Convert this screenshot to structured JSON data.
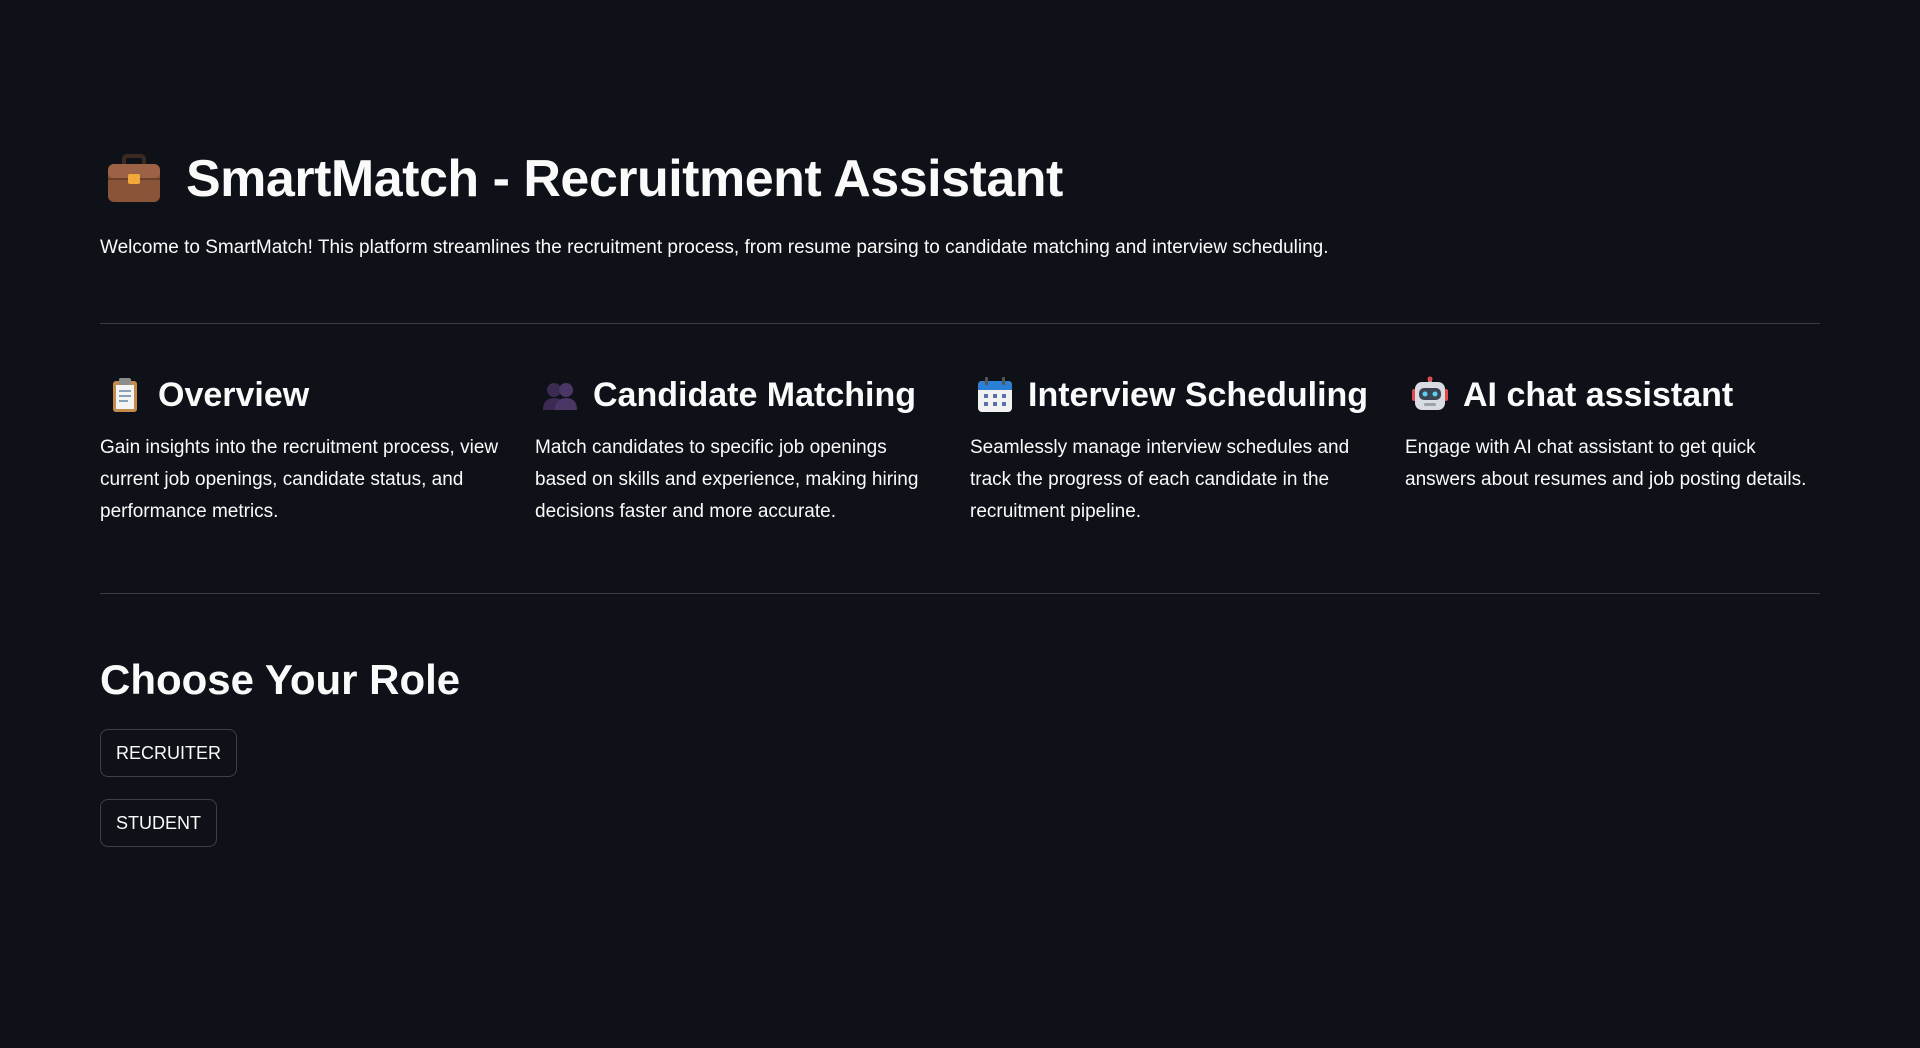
{
  "header": {
    "icon": "briefcase-icon",
    "title": "SmartMatch - Recruitment Assistant",
    "welcome": "Welcome to SmartMatch! This platform streamlines the recruitment process, from resume parsing to candidate matching and interview scheduling."
  },
  "features": [
    {
      "icon": "clipboard-icon",
      "title": "Overview",
      "description": "Gain insights into the recruitment process, view current job openings, candidate status, and performance metrics."
    },
    {
      "icon": "people-icon",
      "title": "Candidate Matching",
      "description": "Match candidates to specific job openings based on skills and experience, making hiring decisions faster and more accurate."
    },
    {
      "icon": "calendar-icon",
      "title": "Interview Scheduling",
      "description": "Seamlessly manage interview schedules and track the progress of each candidate in the recruitment pipeline."
    },
    {
      "icon": "robot-icon",
      "title": "AI chat assistant",
      "description": "Engage with AI chat assistant to get quick answers about resumes and job posting details."
    }
  ],
  "roles": {
    "title": "Choose Your Role",
    "buttons": [
      "RECRUITER",
      "STUDENT"
    ]
  },
  "colors": {
    "background": "#0e1117",
    "text": "#fafafa",
    "divider": "#3a3d45",
    "button_border": "#3d4049"
  }
}
